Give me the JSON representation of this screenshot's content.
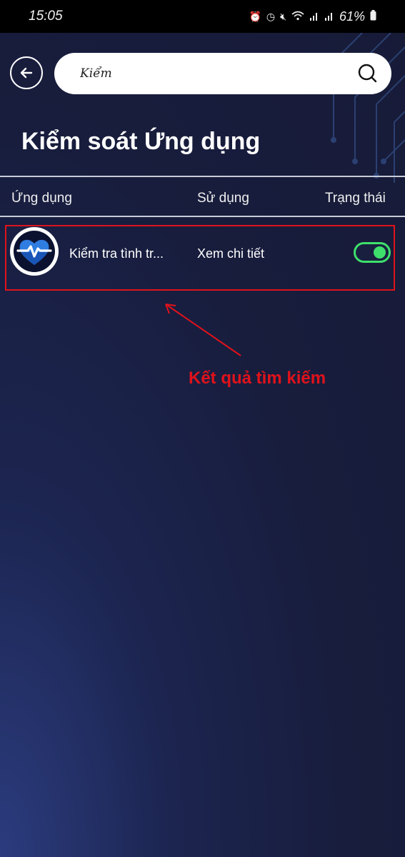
{
  "status_bar": {
    "time": "15:05",
    "battery_text": "61%",
    "icons": [
      "alarm-icon",
      "clock-icon",
      "mute-icon",
      "wifi-icon",
      "signal-icon",
      "signal-icon",
      "battery-icon"
    ]
  },
  "search": {
    "value": "Kiểm",
    "placeholder": ""
  },
  "header": {
    "title": "Kiểm soát Ứng dụng"
  },
  "table": {
    "columns": [
      "Ứng dụng",
      "Sử dụng",
      "Trạng thái"
    ],
    "rows": [
      {
        "app_name": "Kiểm tra tình tr...",
        "usage_link": "Xem chi tiết",
        "status_on": true
      }
    ]
  },
  "annotation": {
    "text": "Kết quả tìm kiếm"
  },
  "colors": {
    "accent_green": "#3ee06b",
    "annotation_red": "#e0121b",
    "background": "#181d3d"
  }
}
